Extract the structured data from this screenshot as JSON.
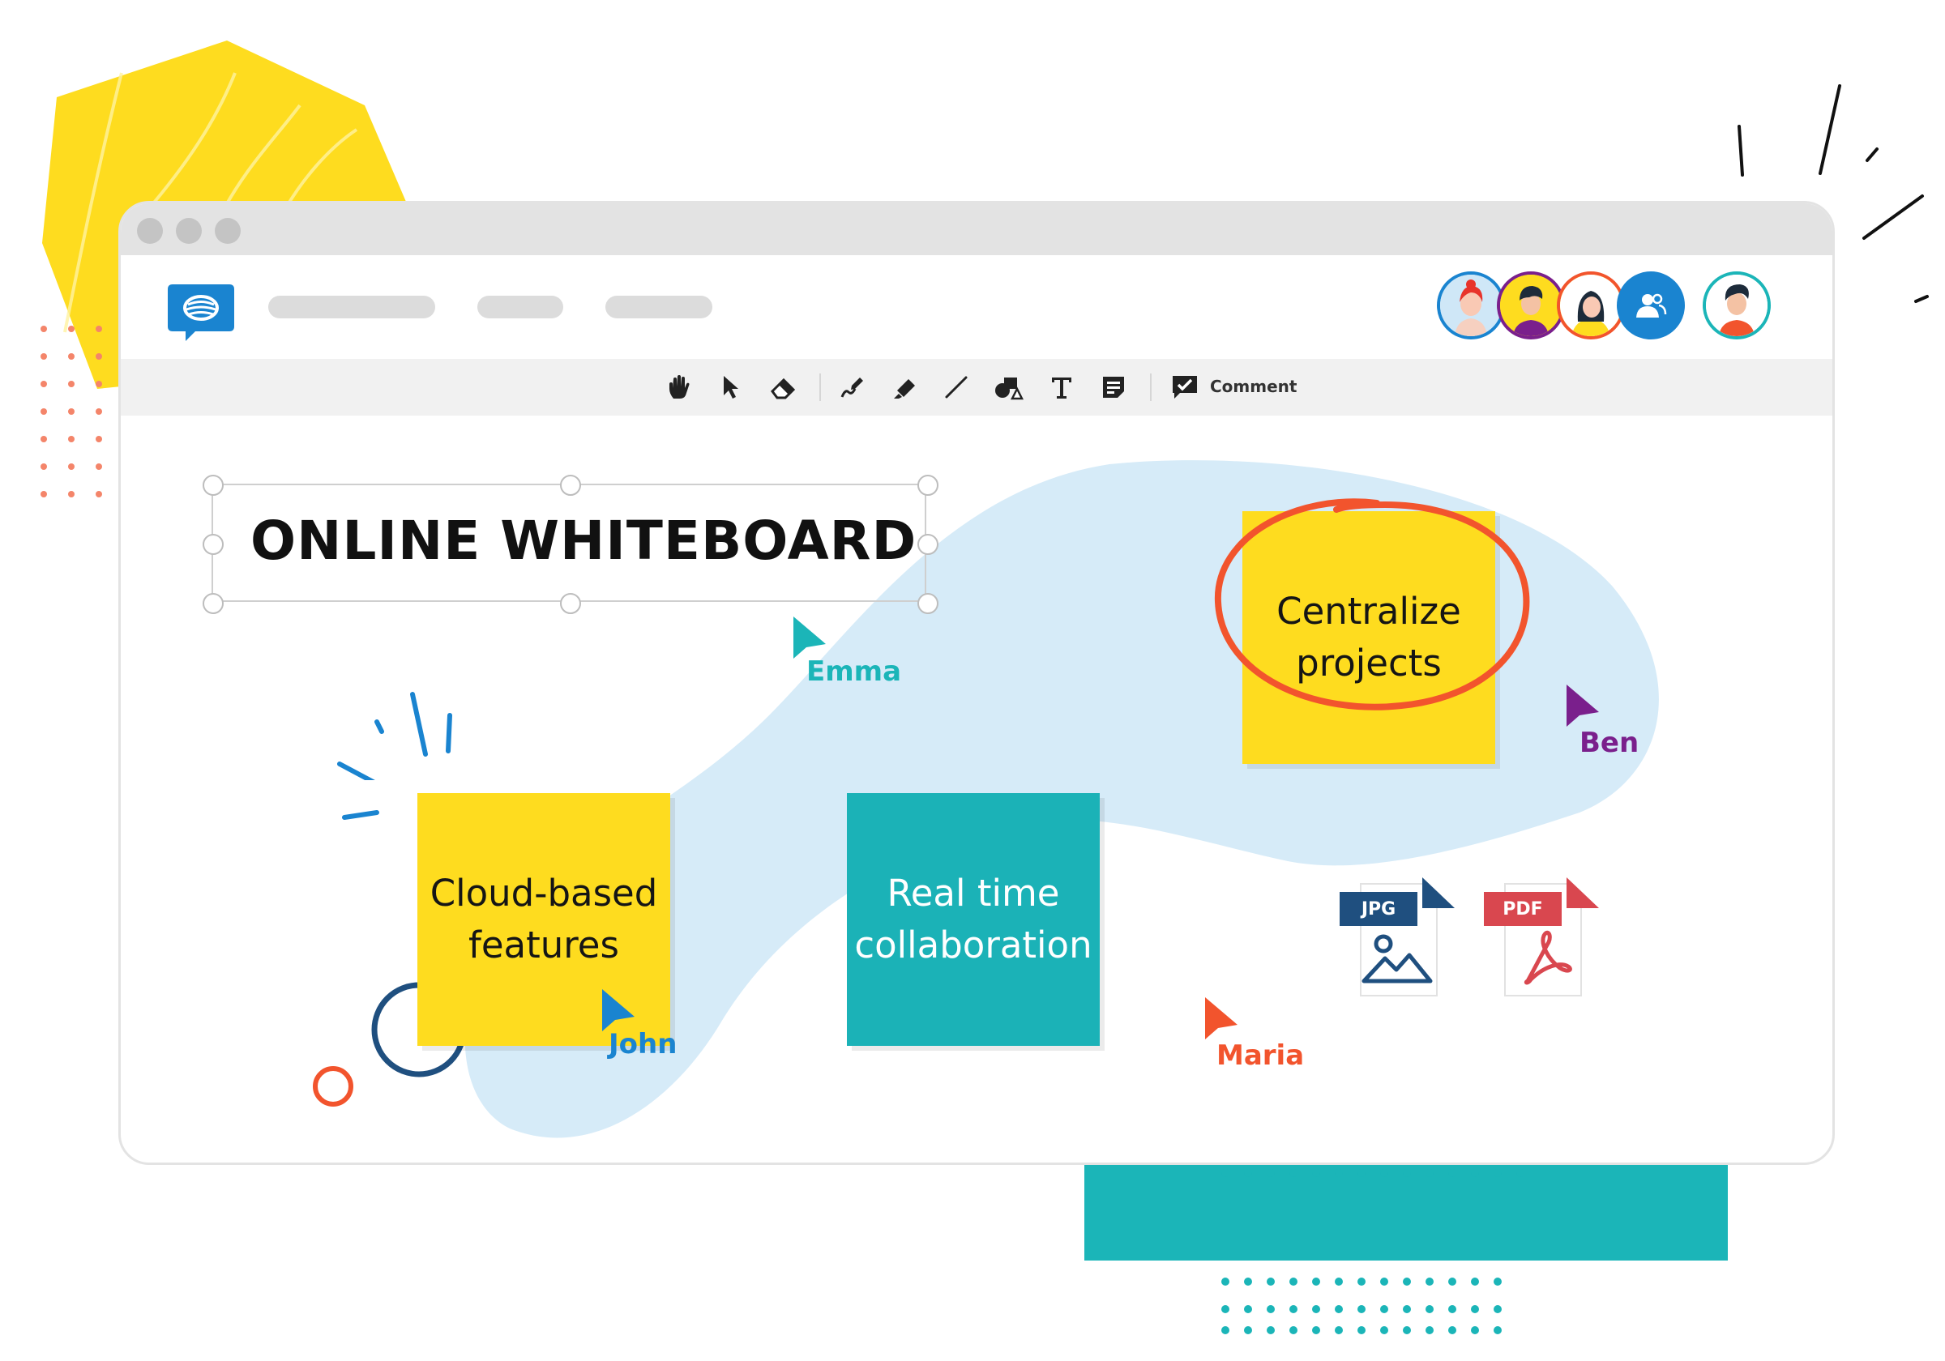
{
  "brand": {
    "accent_blue": "#1a84d0",
    "note_yellow": "#fedc1f",
    "note_teal": "#1bb2b7",
    "highlight_red": "#f2542d"
  },
  "toolbar": {
    "tools": [
      "hand-icon",
      "pointer-icon",
      "eraser-icon",
      "pen-icon",
      "highlighter-icon",
      "line-icon",
      "shapes-icon",
      "text-icon",
      "sticky-note-icon",
      "comment-icon"
    ],
    "comment_label": "Comment"
  },
  "participants": [
    "avatar-red-hair",
    "avatar-man",
    "avatar-woman",
    "participants-icon",
    "avatar-self"
  ],
  "canvas": {
    "title": "ONLINE WHITEBOARD",
    "notes": {
      "cloud": [
        "Cloud-based",
        "features"
      ],
      "realtime": [
        "Real time",
        "collaboration"
      ],
      "centralize": [
        "Centralize",
        "projects"
      ]
    },
    "cursors": {
      "emma": {
        "name": "Emma",
        "color": "#1bb5b8"
      },
      "ben": {
        "name": "Ben",
        "color": "#7a1f8c"
      },
      "john": {
        "name": "John",
        "color": "#1a84d0"
      },
      "maria": {
        "name": "Maria",
        "color": "#f2542d"
      }
    },
    "files": {
      "jpg": {
        "label": "JPG",
        "color": "#1f4f7f"
      },
      "pdf": {
        "label": "PDF",
        "color": "#d9474f"
      }
    }
  }
}
